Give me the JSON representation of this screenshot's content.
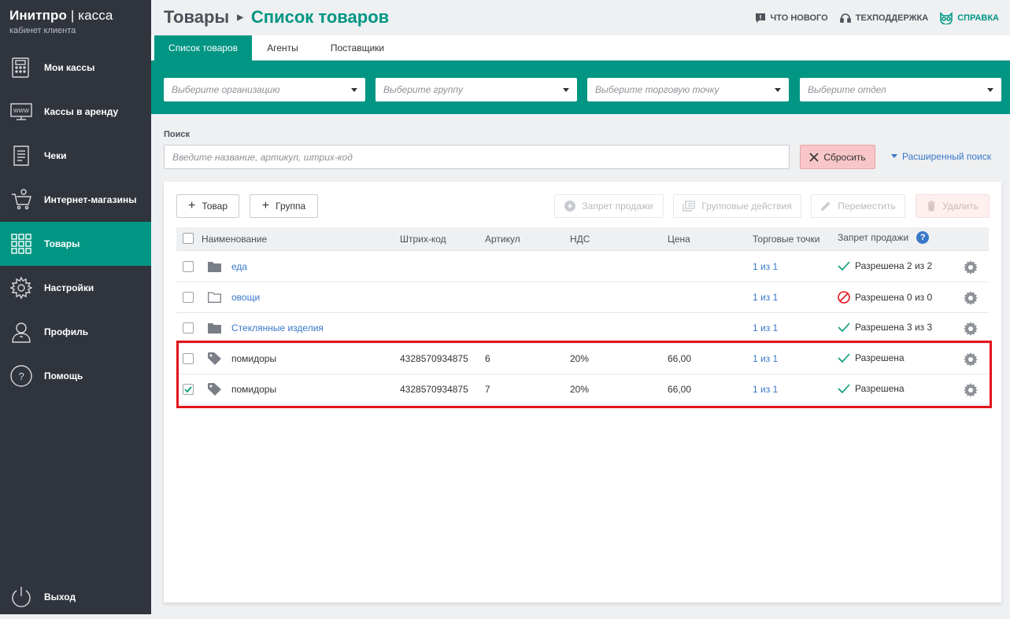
{
  "brand": {
    "name": "Инитпро",
    "separator": "|",
    "product": "касса",
    "subtitle": "кабинет клиента"
  },
  "sidebar": {
    "items": [
      {
        "label": "Мои кассы",
        "icon": "cash-register-icon"
      },
      {
        "label": "Кассы в аренду",
        "icon": "www-monitor-icon"
      },
      {
        "label": "Чеки",
        "icon": "receipt-icon"
      },
      {
        "label": "Интернет-магазины",
        "icon": "cart-icon"
      },
      {
        "label": "Товары",
        "icon": "grid-icon",
        "active": true
      },
      {
        "label": "Настройки",
        "icon": "gear-icon"
      },
      {
        "label": "Профиль",
        "icon": "user-icon"
      },
      {
        "label": "Помощь",
        "icon": "question-icon"
      }
    ],
    "logout": {
      "label": "Выход",
      "icon": "power-icon"
    }
  },
  "header": {
    "crumb_root": "Товары",
    "crumb_current": "Список товаров",
    "links": {
      "whats_new": "ЧТО НОВОГО",
      "support": "ТЕХПОДДЕРЖКА",
      "help": "СПРАВКА"
    }
  },
  "tabs": [
    "Список товаров",
    "Агенты",
    "Поставщики"
  ],
  "filters": {
    "organization": "Выберите организацию",
    "group": "Выберите группу",
    "point": "Выберите торговую точку",
    "department": "Выберите отдел"
  },
  "search": {
    "label": "Поиск",
    "placeholder": "Введите название, артикул, штрих-код",
    "reset": "Сбросить",
    "advanced": "Расширенный поиск"
  },
  "toolbar": {
    "add_product": "Товар",
    "add_group": "Группа",
    "ban_sale": "Запрет продажи",
    "group_actions": "Групповые действия",
    "move": "Переместить",
    "delete": "Удалить"
  },
  "table": {
    "headers": {
      "name": "Наименование",
      "barcode": "Штрих-код",
      "article": "Артикул",
      "vat": "НДС",
      "price": "Цена",
      "points": "Торговые точки",
      "ban": "Запрет продажи"
    },
    "rows": [
      {
        "type": "folder",
        "name": "еда",
        "barcode": "",
        "article": "",
        "vat": "",
        "price": "",
        "points": "1 из 1",
        "status": "Разрешена 2 из 2",
        "state": "ok",
        "checked": false
      },
      {
        "type": "folder-empty",
        "name": "овощи",
        "barcode": "",
        "article": "",
        "vat": "",
        "price": "",
        "points": "1 из 1",
        "status": "Разрешена 0 из 0",
        "state": "banned",
        "checked": false
      },
      {
        "type": "folder",
        "name": "Стеклянные изделия",
        "barcode": "",
        "article": "",
        "vat": "",
        "price": "",
        "points": "1 из 1",
        "status": "Разрешена 3 из 3",
        "state": "ok",
        "checked": false
      },
      {
        "type": "product",
        "name": "помидоры",
        "barcode": "4328570934875",
        "article": "6",
        "vat": "20%",
        "price": "66,00",
        "points": "1 из 1",
        "status": "Разрешена",
        "state": "ok",
        "checked": false
      },
      {
        "type": "product",
        "name": "помидоры",
        "barcode": "4328570934875",
        "article": "7",
        "vat": "20%",
        "price": "66,00",
        "points": "1 из 1",
        "status": "Разрешена",
        "state": "ok",
        "checked": true
      }
    ]
  },
  "colors": {
    "accent": "#009683",
    "sidebar": "#30343d",
    "link": "#3a78c9",
    "highlight": "#e3141b"
  }
}
